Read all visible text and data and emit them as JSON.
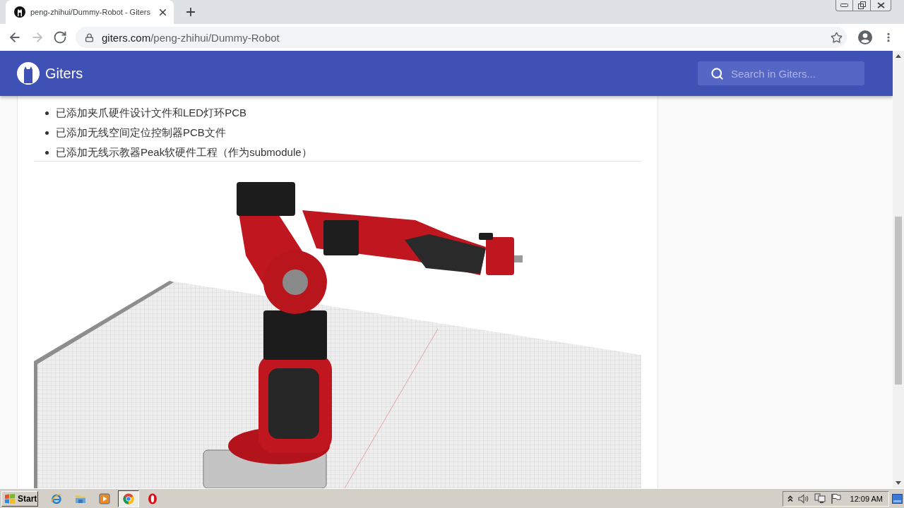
{
  "browser": {
    "tabs": [
      {
        "title": "peng-zhihui/Dummy-Robot - Giters",
        "selected": true
      }
    ],
    "nav_buttons": [
      {
        "kind": "back",
        "disabled": false
      },
      {
        "kind": "forward",
        "disabled": true
      },
      {
        "kind": "reload",
        "disabled": false
      }
    ],
    "address": {
      "domain": "giters.com",
      "path": "/peng-zhihui/Dummy-Robot"
    }
  },
  "header": {
    "site_name": "Giters",
    "search": {
      "placeholder": "Search in Giters..."
    }
  },
  "readme": {
    "list_items": [
      "已添加夹爪硬件设计文件和LED灯环PCB",
      "已添加无线空间定位控制器PCB文件",
      "已添加无线示教器Peak软硬件工程（作为submodule）"
    ]
  },
  "taskbar": {
    "start_label": "Start",
    "apps": [
      {
        "kind": "ie",
        "selected": false
      },
      {
        "kind": "folder",
        "selected": false
      },
      {
        "kind": "media",
        "selected": false
      },
      {
        "kind": "chrome",
        "selected": true
      },
      {
        "kind": "opera",
        "selected": false
      }
    ],
    "clock": "12:09 AM"
  }
}
